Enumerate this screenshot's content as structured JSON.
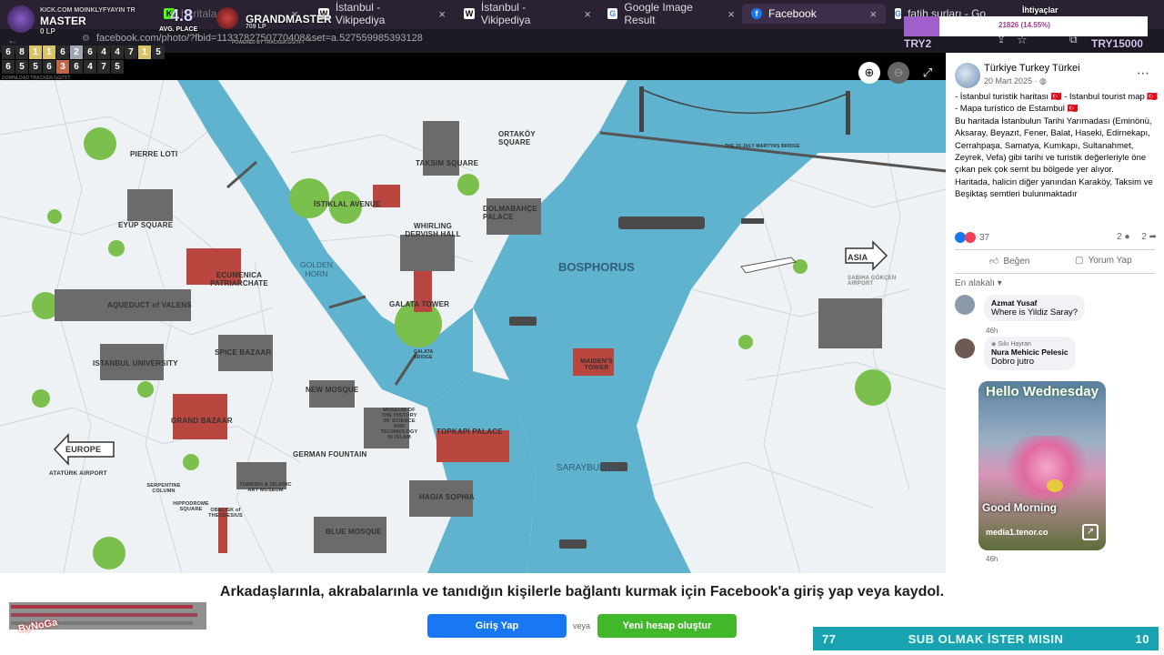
{
  "tabs": [
    {
      "label": "KICK.COM MOINKLYFYAYIN TR",
      "icon": "kick-icon",
      "active": false
    },
    {
      "label": "haritala",
      "icon": "kick-icon",
      "active": false
    },
    {
      "label": "İstanbul - Vikipediya",
      "icon": "wikipedia-icon",
      "active": false
    },
    {
      "label": "İstanbul - Vikipediya",
      "icon": "wikipedia-icon",
      "active": false
    },
    {
      "label": "Google Image Result",
      "icon": "google-icon",
      "active": false
    },
    {
      "label": "Facebook",
      "icon": "facebook-icon",
      "active": true
    },
    {
      "label": "fatih surları - Google'da Ara",
      "icon": "google-icon",
      "active": false
    }
  ],
  "address": {
    "url": "facebook.com/photo/?fbid=1133782750770408&set=a.527559985393128"
  },
  "overlay": {
    "rank1": "MASTER",
    "rank1_lp": "0 LP",
    "avg_value": "4.8",
    "avg_label": "AVG. PLACE",
    "rank2": "GRANDMASTER",
    "rank2_lp": "709 LP",
    "powered": "POWERED BY TRACKER.GG/TFT",
    "row1": [
      "6",
      "8",
      "1",
      "1",
      "6",
      "2",
      "6",
      "4",
      "4",
      "7",
      "1",
      "5"
    ],
    "row2": [
      "6",
      "5",
      "5",
      "6",
      "3",
      "6",
      "4",
      "7",
      "5"
    ],
    "tracker_url": "DOWNLOAD TRACKER.GG/TFT",
    "goal_left": "TRY2",
    "goal_right": "TRY15000",
    "goal_progress": "21826 (14.55%)",
    "goal_title": "İhtiyaçlar",
    "progress_fraction": 0.1455,
    "sub_left": "77",
    "sub_text": "SUB OLMAK İSTER MISIN",
    "sub_right": "10",
    "logo_text": "ByNoGa"
  },
  "map": {
    "labels": {
      "pierre_loti": "PIERRE LOTI",
      "eyup": "EYÜP SQUARE",
      "istiklal": "İSTIKLAL AVENUE",
      "taksim": "TAKSIM SQUARE",
      "ortakoy": "ORTAKÖY SQUARE",
      "bridge15": "THE 15 JULY MARTYRS BRIDGE",
      "dolmabahce": "DOLMABAHÇE PALACE",
      "whirling": "WHIRLING DERVISH HALL",
      "aqueduct": "AQUEDUCT of VALENS",
      "ecumenica": "ECUMENICA PATRIARCHATE",
      "galata": "GALATA TOWER",
      "bosphorus": "BOSPHORUS",
      "golden_horn": "GOLDEN HORN",
      "asia": "ASIA",
      "sabiha": "SABIHA GÖKÇEN AIRPORT",
      "university": "ISTANBUL UNIVERSITY",
      "spice": "SPICE BAZAAR",
      "maiden": "MAIDEN'S TOWER",
      "galata_bridge": "GALATA BRIDGE",
      "new_mosque": "NEW MOSQUE",
      "museum_science": "MUSEUM OF THE HISTORY OF SCIENCE AND TECHNOLOGY IN ISLAM",
      "grand_bazaar": "GRAND BAZAAR",
      "topkapi": "TOPKAPI PALACE",
      "german": "GERMAN FOUNTAIN",
      "europe": "EUROPE",
      "ataturk": "ATATÜRK AIRPORT",
      "serpentine": "SERPENTINE COLUMN",
      "hippodrome": "HIPPODROME SQUARE",
      "obelisk": "OBELISK of THEODESIUS",
      "turkish_museum": "TURKISH & ISLAMIC ART MUSEUM",
      "hagia": "HAGIA SOPHIA",
      "sarayburnu": "SARAYBURNU",
      "blue_mosque": "BLUE MOSQUE"
    }
  },
  "post": {
    "author": "Türkiye Turkey Türkei",
    "date": "20 Mart 2025 · ",
    "text_lines": [
      "- İstanbul turistik haritası 🇹🇷 - Istanbul tourist map 🇹🇷 - Mapa turístico de Estambul 🇹🇷",
      "Bu haritada İstanbulun Tarihi Yarımadası (Eminönü, Aksaray, Beyazıt, Fener, Balat, Haseki, Edirnekapı, Cerrahpaşa, Samatya, Kumkapı, Sultanahmet, Zeyrek, Vefa) gibi tarihi ve turistik değerleriyle öne çıkan pek çok semt bu bölgede yer alıyor.",
      "Haritada, halicin diğer yanından Karaköy, Taksim ve Beşiktaş semtleri bulunmaktadır"
    ],
    "reaction_count": "37",
    "comments_count": "2",
    "shares_count": "2",
    "like_label": "Beğen",
    "comment_label": "Yorum Yap",
    "sort_label": "En alakalı",
    "comments": [
      {
        "name": "Azmat Yusaf",
        "text": "Where is Yildiz Saray?",
        "time": "46h"
      },
      {
        "badge": "Sıkı Hayran",
        "name": "Nura Mehicic Pelesic",
        "text": "Dobro jutro",
        "time": ""
      }
    ],
    "gif": {
      "title": "Hello Wednesday",
      "caption": "Good Morning",
      "source": "media1.tenor.co",
      "time": "46h"
    }
  },
  "footer": {
    "cta": "Arkadaşlarınla, akrabalarınla ve tanıdığın kişilerle bağlantı kurmak için Facebook'a giriş yap veya kaydol.",
    "login": "Giriş Yap",
    "or": "veya",
    "signup": "Yeni hesap oluştur"
  },
  "colors": {
    "fb_blue": "#1877f2",
    "fb_green": "#42b72a",
    "water": "#5fb3cf",
    "tabbar": "#2a2233"
  }
}
